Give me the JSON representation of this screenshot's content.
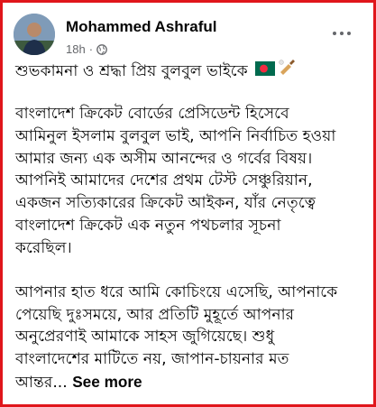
{
  "post": {
    "author": "Mohammed Ashraful",
    "time": "18h",
    "dot": "·",
    "lines_p1": [
      "শুভকামনা ও শ্রদ্ধা প্রিয় বুলবুল ভাইকে"
    ],
    "lines_p2": [
      "বাংলাদেশ ক্রিকেট বোর্ডের প্রেসিডেন্ট হিসেবে",
      "আমিনুল ইসলাম বুলবুল ভাই, আপনি নির্বাচিত হওয়া",
      "আমার জন্য এক অসীম আনন্দের ও গর্বের বিষয়।",
      "আপনিই আমাদের দেশের প্রথম টেস্ট সেঞ্চুরিয়ান,",
      "একজন সত্যিকারের ক্রিকেট আইকন, যাঁর নেতৃত্বে",
      "বাংলাদেশ ক্রিকেট এক নতুন পথচলার সূচনা",
      "করেছিল।"
    ],
    "lines_p3": [
      "আপনার হাত ধরে আমি কোচিংয়ে এসেছি, আপনাকে",
      "পেয়েছি দুঃসময়ে, আর প্রতিটি মুহূর্তে আপনার",
      "অনুপ্রেরণাই আমাকে সাহস জুগিয়েছে। শুধু",
      "বাংলাদেশের মাটিতে নয়, জাপান-চায়নার মত"
    ],
    "truncated_tail": "আন্তর...",
    "see_more": "See more"
  },
  "icons": {
    "privacy": "globe-icon",
    "menu": "more-options-icon",
    "emoji1": "bangladesh-flag-icon",
    "emoji2": "cricket-bat-icon"
  },
  "colors": {
    "frame_border": "#e0161b",
    "text": "#050505",
    "meta": "#65676b",
    "flag_green": "#006a4e",
    "flag_red": "#f42a41"
  }
}
